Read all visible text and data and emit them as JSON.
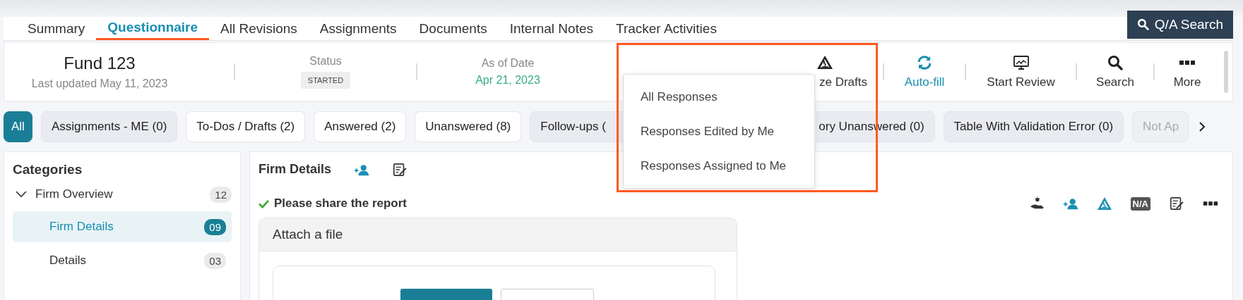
{
  "tabs": [
    {
      "label": "Summary",
      "selected": false
    },
    {
      "label": "Questionnaire",
      "selected": true
    },
    {
      "label": "All Revisions",
      "selected": false
    },
    {
      "label": "Assignments",
      "selected": false
    },
    {
      "label": "Documents",
      "selected": false
    },
    {
      "label": "Internal Notes",
      "selected": false
    },
    {
      "label": "Tracker Activities",
      "selected": false
    }
  ],
  "qa_search": {
    "label": "Q/A Search"
  },
  "header": {
    "fund": {
      "name": "Fund 123",
      "last_updated": "Last updated May 11, 2023"
    },
    "status": {
      "label": "Status",
      "value": "STARTED"
    },
    "as_of": {
      "label": "As of Date",
      "value": "Apr 21, 2023"
    },
    "actions": [
      {
        "kind": "drafts",
        "label": "ze Drafts",
        "highlighted": false
      },
      {
        "kind": "autofill",
        "label": "Auto-fill",
        "highlighted": true
      },
      {
        "kind": "review",
        "label": "Start Review",
        "highlighted": false
      },
      {
        "kind": "search",
        "label": "Search",
        "highlighted": false
      },
      {
        "kind": "more",
        "label": "More",
        "highlighted": false
      }
    ]
  },
  "filters": [
    {
      "label": "All",
      "selected": true,
      "disabled": false
    },
    {
      "label": "Assignments - ME (0)",
      "selected": false,
      "disabled": true
    },
    {
      "label": "To-Dos / Drafts (2)",
      "selected": false,
      "disabled": false
    },
    {
      "label": "Answered (2)",
      "selected": false,
      "disabled": false
    },
    {
      "label": "Unanswered (8)",
      "selected": false,
      "disabled": false
    },
    {
      "label": "Follow-ups (",
      "selected": false,
      "disabled": true
    },
    {
      "label": "ory Unanswered (0)",
      "selected": false,
      "disabled": true
    },
    {
      "label": "Table With Validation Error (0)",
      "selected": false,
      "disabled": true
    },
    {
      "label": "Not Ap",
      "selected": false,
      "disabled": true
    }
  ],
  "dropdown": {
    "items": [
      "All Responses",
      "Responses Edited by Me",
      "Responses Assigned to Me"
    ]
  },
  "categories": {
    "title": "Categories",
    "items": [
      {
        "label": "Firm Overview",
        "count": "12",
        "expanded": true,
        "selected": false,
        "children": [
          {
            "label": "Firm Details",
            "count": "09",
            "selected": true
          },
          {
            "label": "Details",
            "count": "03",
            "selected": false
          }
        ]
      }
    ]
  },
  "section": {
    "title": "Firm Details",
    "title_actions": [
      {
        "kind": "assign"
      },
      {
        "kind": "edit"
      }
    ],
    "question": {
      "text": "Please share the report",
      "answered": true
    },
    "question_actions": [
      {
        "kind": "hint"
      },
      {
        "kind": "assign"
      },
      {
        "kind": "draft"
      },
      {
        "kind": "na",
        "label": "N/A"
      },
      {
        "kind": "edit"
      },
      {
        "kind": "more"
      }
    ],
    "attachment": {
      "title": "Attach a file"
    }
  }
}
